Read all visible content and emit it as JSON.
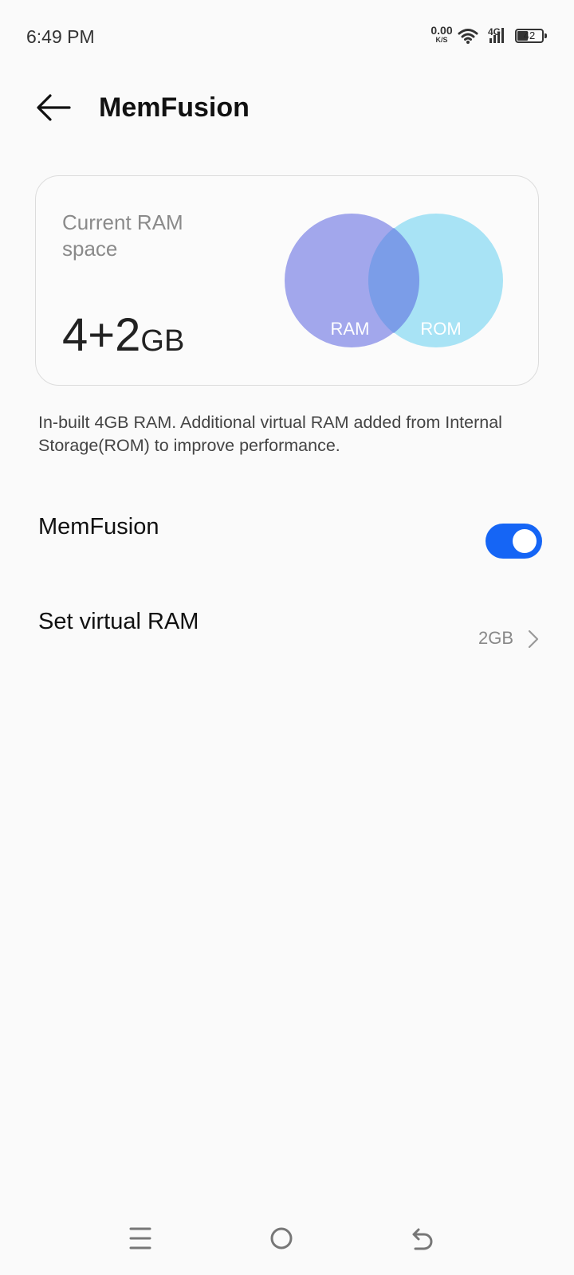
{
  "status_bar": {
    "time": "6:49 PM",
    "net_speed_value": "0.00",
    "net_speed_unit": "K/S",
    "network_type": "4G",
    "battery_level": "42",
    "icons": [
      "wifi-icon",
      "signal-icon",
      "battery-icon"
    ]
  },
  "header": {
    "title": "MemFusion",
    "back_icon": "back-arrow-icon"
  },
  "ram_card": {
    "label": "Current RAM space",
    "total_number": "4+2",
    "total_unit": "GB",
    "diagram": {
      "left_label": "RAM",
      "right_label": "ROM",
      "left_color": "#a2a7ec",
      "right_color": "#a8e3f5",
      "overlap_color": "#7b9de8"
    }
  },
  "description": "In-built 4GB RAM. Additional virtual RAM added from Internal Storage(ROM) to improve performance.",
  "memfusion_row": {
    "label": "MemFusion",
    "toggle_on": true,
    "toggle_color": "#1565f5"
  },
  "virtual_ram_row": {
    "label": "Set virtual RAM",
    "value": "2GB"
  },
  "nav_bar": {
    "icons": [
      "menu-icon",
      "home-icon",
      "back-icon"
    ]
  }
}
